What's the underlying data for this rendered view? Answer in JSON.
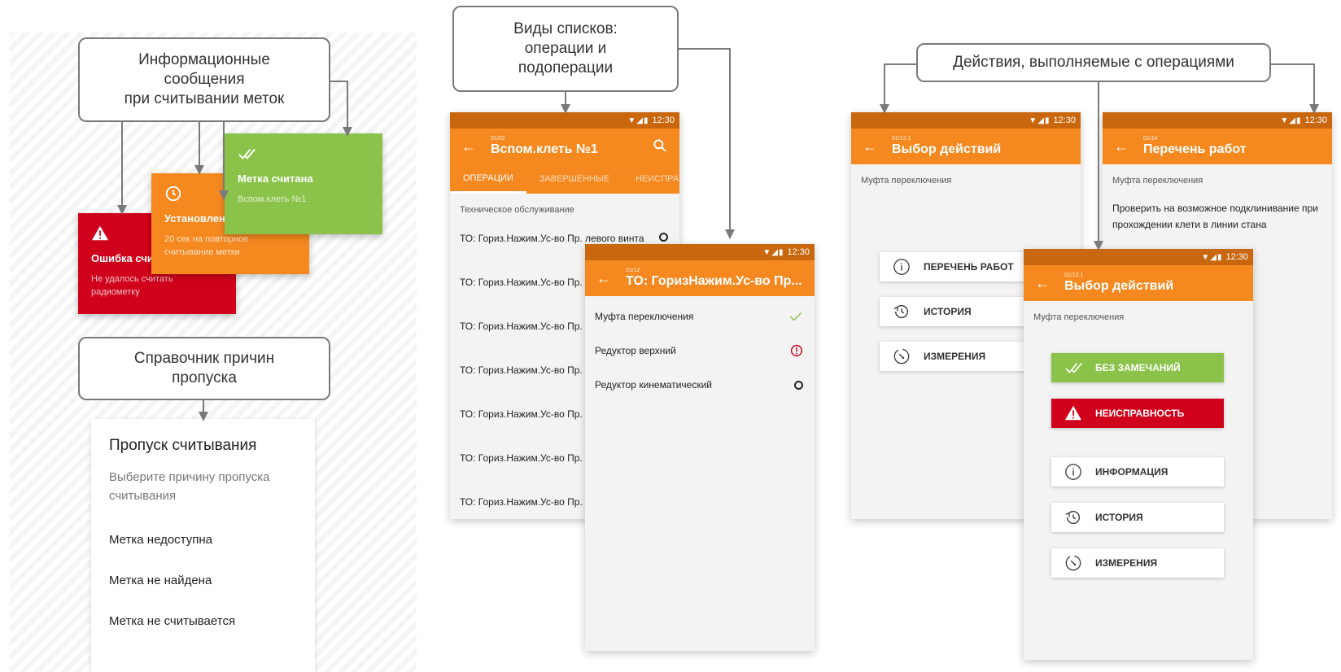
{
  "callouts": {
    "info_messages": "Информационные\nсообщения\nпри считывании меток",
    "skip_reasons": "Справочник причин\nпропуска",
    "list_types": "Виды списков:\nоперации и\nподоперации",
    "actions": "Действия, выполняемые с операциями"
  },
  "notifications": {
    "error": {
      "title": "Ошибка считывания",
      "text": "Не удалось считать радиометку"
    },
    "timeout": {
      "title": "Установлен таймаут",
      "text": "20 сек на повторное считывание метки"
    },
    "success": {
      "title": "Метка считана",
      "text": "Вспом.клеть №1"
    }
  },
  "skip_dialog": {
    "title": "Пропуск считывания",
    "subtitle": "Выберите причину пропуска считывания",
    "options": [
      "Метка недоступна",
      "Метка не найдена",
      "Метка не считывается"
    ]
  },
  "status_time": "12:30",
  "ops_screen": {
    "code": "01/02",
    "title": "Вспом.клеть №1",
    "tabs": [
      "ОПЕРАЦИИ",
      "ЗАВЕРШЁННЫЕ",
      "НЕИСПРАВНОСТИ"
    ],
    "section": "Техническое обслуживание",
    "items": [
      "ТО: Гориз.Нажим.Ус-во Пр. левого винта",
      "ТО: Гориз.Нажим.Ус-во Пр. левого винта",
      "ТО: Гориз.Нажим.Ус-во Пр. левого винта",
      "ТО: Гориз.Нажим.Ус-во Пр. левого винта",
      "ТО: Гориз.Нажим.Ус-во Пр. левого винта",
      "ТО: Гориз.Нажим.Ус-во Пр. левого винта",
      "ТО: Гориз.Нажим.Ус-во Пр. левого винта"
    ]
  },
  "subops_screen": {
    "code": "01/12",
    "title": "ТО: ГоризНажим.Ус-во Пр...",
    "items": [
      {
        "label": "Муфта переключения",
        "status": "done"
      },
      {
        "label": "Редуктор верхний",
        "status": "fault"
      },
      {
        "label": "Редуктор кинематический",
        "status": "pending"
      }
    ]
  },
  "actions_a": {
    "code": "01/12.1",
    "title": "Выбор действий",
    "subtitle": "Муфта переключения",
    "buttons": [
      "ПЕРЕЧЕНЬ РАБОТ",
      "ИСТОРИЯ",
      "ИЗМЕРЕНИЯ"
    ]
  },
  "works_screen": {
    "code": "01/14",
    "title": "Перечень работ",
    "subtitle": "Муфта переключения",
    "text": "Проверить на возможное подклинивание при прохождении клети в линии стана"
  },
  "actions_b": {
    "code": "01/12.1",
    "title": "Выбор действий",
    "subtitle": "Муфта переключения",
    "ok_button": "БЕЗ ЗАМЕЧАНИЙ",
    "fault_button": "НЕИСПРАВНОСТЬ",
    "buttons": [
      "ИНФОРМАЦИЯ",
      "ИСТОРИЯ",
      "ИЗМЕРЕНИЯ"
    ]
  },
  "colors": {
    "primary": "#f5891f",
    "status_bar": "#c8670e",
    "error": "#d0021b",
    "success": "#8bc34a"
  }
}
